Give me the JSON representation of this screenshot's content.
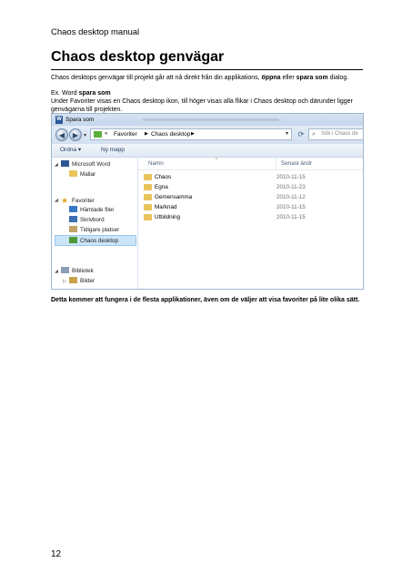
{
  "header": "Chaos desktop manual",
  "title": "Chaos desktop genvägar",
  "paragraph1": {
    "a": "Chaos desktops genvägar till projekt går att nå direkt från din applikations, ",
    "b": "öppna",
    "c": " eller ",
    "d": "spara som",
    "e": " dialog."
  },
  "paragraph2": {
    "a": "Ex. Word ",
    "b": "spara som"
  },
  "paragraph3": "Under Favoriter visas en Chaos desktop ikon, till höger visas alla flikar i Chaos desktop och därunder ligger genvägarna till projekten.",
  "dialog": {
    "title": "Spara som",
    "breadcrumb": [
      "Favoriter",
      "Chaos desktop"
    ],
    "search_placeholder": "Sök i Chaos de",
    "toolbar": {
      "organize": "Ordna ▾",
      "new_folder": "Ny mapp"
    },
    "nav_items": [
      {
        "label": "Microsoft Word",
        "icon": "word-icon"
      },
      {
        "label": "Mallar",
        "icon": "folder-icon"
      },
      {
        "label": "Favoriter",
        "icon": "star-icon"
      },
      {
        "label": "Hämtade filer",
        "icon": "downloads-icon"
      },
      {
        "label": "Skrivbord",
        "icon": "desktop-icon"
      },
      {
        "label": "Tidigare platser",
        "icon": "recent-places-icon"
      },
      {
        "label": "Chaos desktop",
        "icon": "chaos-desktop-icon",
        "selected": true
      },
      {
        "label": "Bibliotek",
        "icon": "libraries-icon"
      },
      {
        "label": "Bilder",
        "icon": "pictures-icon"
      }
    ],
    "columns": {
      "name": "Namn",
      "date": "Senast ändr"
    },
    "files": [
      {
        "name": "Chaos",
        "date": "2010-11-15"
      },
      {
        "name": "Egna",
        "date": "2010-11-23"
      },
      {
        "name": "Gemensamma",
        "date": "2010-11-12"
      },
      {
        "name": "Marknad",
        "date": "2010-11-15"
      },
      {
        "name": "Utbildning",
        "date": "2010-11-15"
      }
    ]
  },
  "caption": "Detta kommer att fungera i de flesta applikationer, även om de väljer att visa favoriter på lite olika sätt.",
  "page_number": "12"
}
